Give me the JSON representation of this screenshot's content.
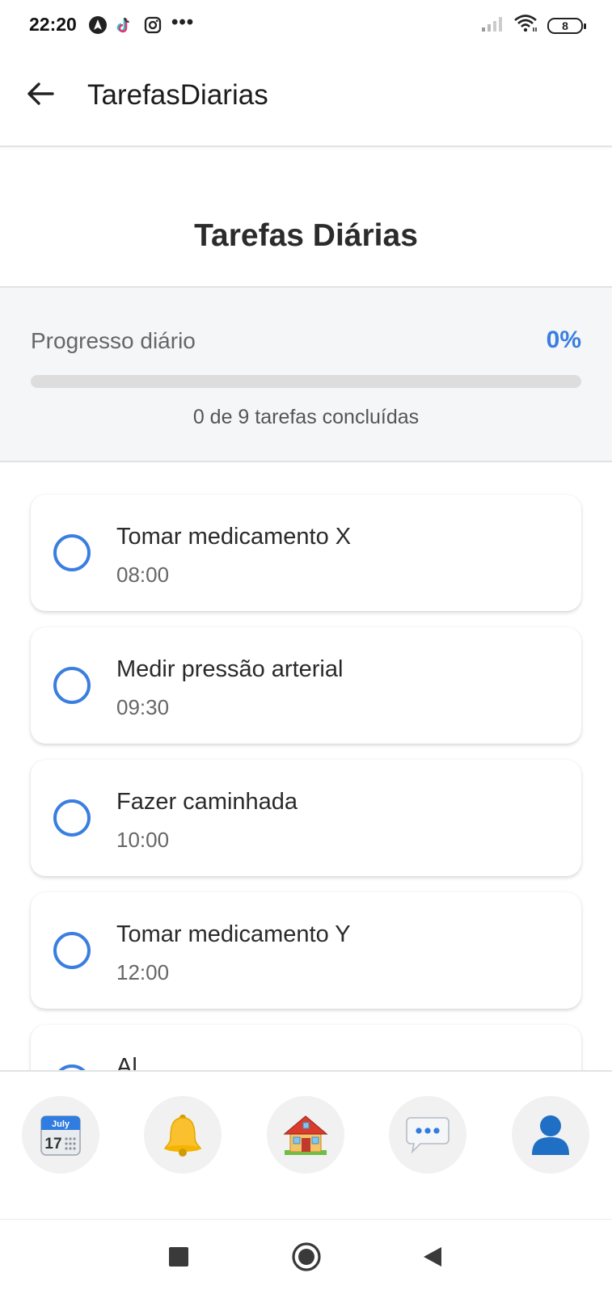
{
  "status_bar": {
    "time": "22:20",
    "icons": [
      "navigation-icon",
      "tiktok-icon",
      "instagram-icon"
    ],
    "more": "•••",
    "battery": "8"
  },
  "app_bar": {
    "title": "TarefasDiarias",
    "back_icon": "arrow-left-icon"
  },
  "page": {
    "title": "Tarefas Diárias"
  },
  "progress": {
    "label": "Progresso diário",
    "percent_text": "0%",
    "fraction": 0,
    "summary": "0 de 9 tarefas concluídas",
    "accent": "#3a7ee0"
  },
  "tasks": [
    {
      "title": "Tomar medicamento X",
      "time": "08:00",
      "done": false
    },
    {
      "title": "Medir pressão arterial",
      "time": "09:30",
      "done": false
    },
    {
      "title": "Fazer caminhada",
      "time": "10:00",
      "done": false
    },
    {
      "title": "Tomar medicamento Y",
      "time": "12:00",
      "done": false
    },
    {
      "title": "Al",
      "time": "",
      "done": false
    }
  ],
  "bottom_nav": {
    "items": [
      {
        "icon": "calendar-icon",
        "calendar_month": "July",
        "calendar_day": "17"
      },
      {
        "icon": "bell-icon"
      },
      {
        "icon": "house-icon"
      },
      {
        "icon": "chat-bubble-icon"
      },
      {
        "icon": "user-icon"
      }
    ]
  },
  "system_nav": [
    "recents-icon",
    "home-circle-icon",
    "back-triangle-icon"
  ]
}
